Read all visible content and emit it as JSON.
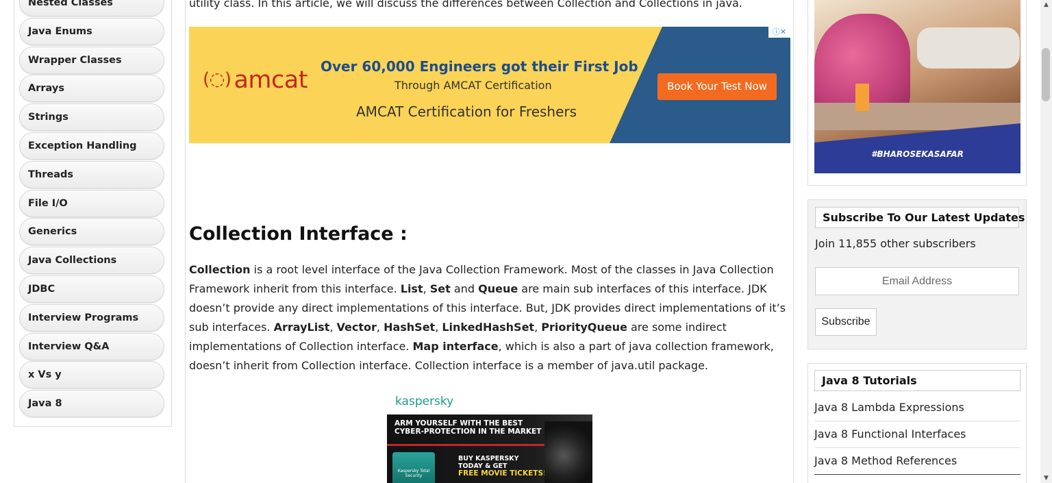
{
  "sidebar": {
    "items": [
      {
        "label": "Nested Classes"
      },
      {
        "label": "Java Enums"
      },
      {
        "label": "Wrapper Classes"
      },
      {
        "label": "Arrays"
      },
      {
        "label": "Strings"
      },
      {
        "label": "Exception Handling"
      },
      {
        "label": "Threads"
      },
      {
        "label": "File I/O"
      },
      {
        "label": "Generics"
      },
      {
        "label": "Java Collections"
      },
      {
        "label": "JDBC"
      },
      {
        "label": "Interview Programs"
      },
      {
        "label": "Interview Q&A"
      },
      {
        "label": "x Vs y"
      },
      {
        "label": "Java 8"
      }
    ]
  },
  "article": {
    "intro": "utility class. In this article, we will discuss the differences between Collection and Collections in java.",
    "section_title": "Collection Interface :",
    "para": {
      "s1b": "Collection",
      "s1": " is a root level interface of the Java Collection Framework. Most of the classes in Java Collection Framework inherit from this interface. ",
      "s2b": "List",
      "s2": ", ",
      "s3b": "Set",
      "s3": " and ",
      "s4b": "Queue",
      "s4": " are main sub interfaces of this interface. JDK doesn’t provide any direct implementations of this interface. But, JDK provides direct implementations of it’s sub interfaces. ",
      "s5b": "ArrayList",
      "s5": ", ",
      "s6b": "Vector",
      "s6": ", ",
      "s7b": "HashSet",
      "s7": ", ",
      "s8b": "LinkedHashSet",
      "s8": ", ",
      "s9b": "PriorityQueue",
      "s9": " are some indirect implementations of Collection interface. ",
      "s10b": "Map interface",
      "s10": ", which is also a part of java collection framework, doesn’t inherit from Collection interface. Collection interface is a member of java.util package."
    }
  },
  "ads": {
    "amcat": {
      "logo": "amcat",
      "logo_mark": "(◌)",
      "headline": "Over 60,000 Engineers got their First Job",
      "subline": "Through AMCAT Certification",
      "tagline": "AMCAT Certification for Freshers",
      "cta": "Book Your Test Now",
      "adchoices": "ⓘ✕"
    },
    "kaspersky": {
      "logo": "kaspersky",
      "line1": "ARM YOURSELF WITH THE BEST",
      "line2": "CYBER-PROTECTION IN THE MARKET",
      "box": "Kaspersky Total Security",
      "buy1": "BUY KASPERSKY",
      "buy2": "TODAY & GET",
      "free": "FREE MOVIE TICKETS!"
    },
    "photo_hashtag": "#BHAROSEKASAFAR"
  },
  "subscribe": {
    "title": "Subscribe To Our Latest Updates",
    "subscribers": "Join 11,855 other subscribers",
    "email_placeholder": "Email Address",
    "button": "Subscribe"
  },
  "java8": {
    "title": "Java 8 Tutorials",
    "items": [
      {
        "label": "Java 8 Lambda Expressions"
      },
      {
        "label": "Java 8 Functional Interfaces"
      },
      {
        "label": "Java 8 Method References"
      }
    ]
  },
  "scrollbar": {
    "up": "▲",
    "down": "▼"
  }
}
